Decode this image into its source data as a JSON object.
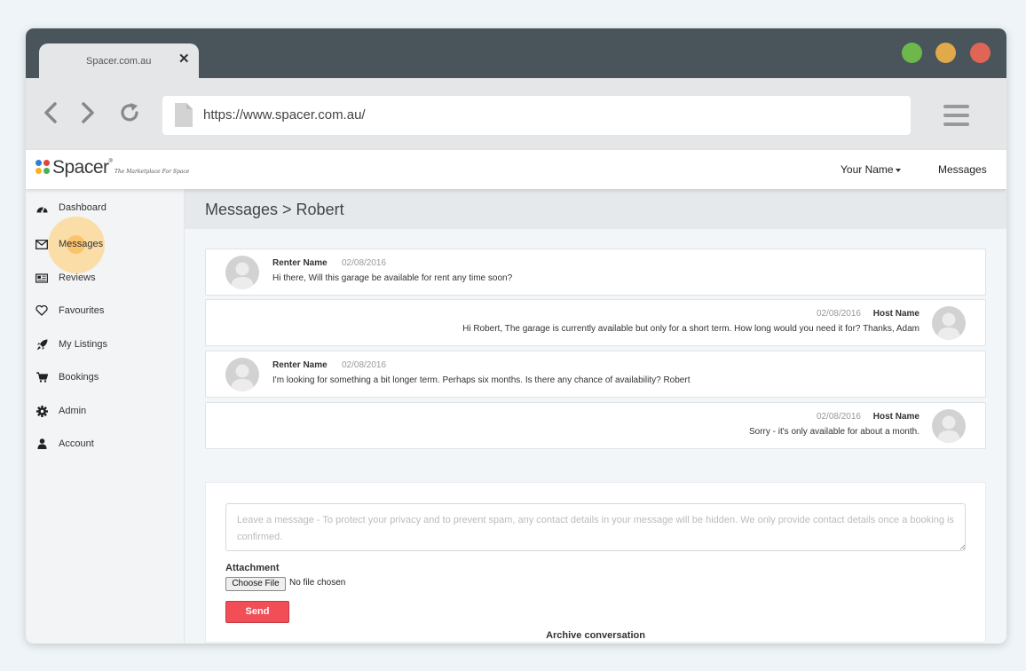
{
  "browser": {
    "tab_title": "Spacer.com.au",
    "url": "https://www.spacer.com.au/",
    "traffic_colors": [
      "#6cb84a",
      "#e0a94a",
      "#df6556"
    ]
  },
  "site": {
    "brand": "Spacer",
    "brand_mark": "®",
    "tagline": "The Marketplace For Space",
    "logo_colors": [
      "#2f7fd6",
      "#e2453a",
      "#f5b321",
      "#4caf50"
    ],
    "nav_user": "Your Name",
    "nav_messages": "Messages"
  },
  "sidebar": {
    "items": [
      {
        "label": "Dashboard",
        "icon": "dashboard-icon"
      },
      {
        "label": "Messages",
        "icon": "envelope-icon"
      },
      {
        "label": "Reviews",
        "icon": "newspaper-icon"
      },
      {
        "label": "Favourites",
        "icon": "heart-icon"
      },
      {
        "label": "My Listings",
        "icon": "rocket-icon"
      },
      {
        "label": "Bookings",
        "icon": "cart-icon"
      },
      {
        "label": "Admin",
        "icon": "gear-icon"
      },
      {
        "label": "Account",
        "icon": "user-icon"
      }
    ]
  },
  "page": {
    "title": "Messages > Robert"
  },
  "messages": [
    {
      "sender": "Renter Name",
      "date": "02/08/2016",
      "text": "Hi there, Will this garage be available for rent any time soon?"
    },
    {
      "sender": "Host Name",
      "date": "02/08/2016",
      "text": "Hi Robert, The garage is currently available but only for a short term. How long would you need it for? Thanks, Adam"
    },
    {
      "sender": "Renter Name",
      "date": "02/08/2016",
      "text": "I'm looking for something a bit longer term. Perhaps six months. Is there any chance of availability? Robert"
    },
    {
      "sender": "Host Name",
      "date": "02/08/2016",
      "text": "Sorry - it's only available for about a month."
    }
  ],
  "compose": {
    "placeholder": "Leave a message - To protect your privacy and to prevent spam, any contact details in your message will be hidden. We only provide contact details once a booking is confirmed.",
    "attachment_label": "Attachment",
    "choose_file": "Choose File",
    "file_status": "No file chosen",
    "send_label": "Send"
  },
  "archive_label": "Archive conversation"
}
